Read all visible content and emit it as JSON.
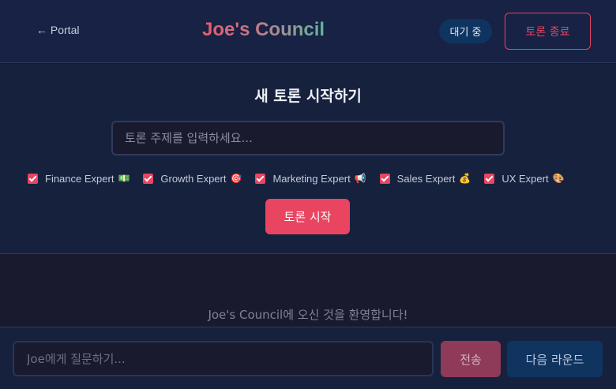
{
  "header": {
    "back_label": "← Portal",
    "title": "Joe's Council",
    "status": "대기 중",
    "end_label": "토론 종료"
  },
  "setup": {
    "title": "새 토론 시작하기",
    "topic_placeholder": "토론 주제를 입력하세요...",
    "experts": [
      {
        "label": "Finance Expert",
        "emoji": "💵",
        "checked": true
      },
      {
        "label": "Growth Expert",
        "emoji": "🎯",
        "checked": true
      },
      {
        "label": "Marketing Expert",
        "emoji": "📢",
        "checked": true
      },
      {
        "label": "Sales Expert",
        "emoji": "💰",
        "checked": true
      },
      {
        "label": "UX Expert",
        "emoji": "🎨",
        "checked": true
      }
    ],
    "start_label": "토론 시작"
  },
  "messages": {
    "welcome": "Joe's Council에 오신 것을 환영합니다!"
  },
  "composer": {
    "placeholder": "Joe에게 질문하기...",
    "send_label": "전송",
    "next_round_label": "다음 라운드"
  },
  "colors": {
    "accent": "#e94560",
    "background": "#1a1a2e",
    "panel": "#16213e",
    "secondary": "#0f3460"
  }
}
